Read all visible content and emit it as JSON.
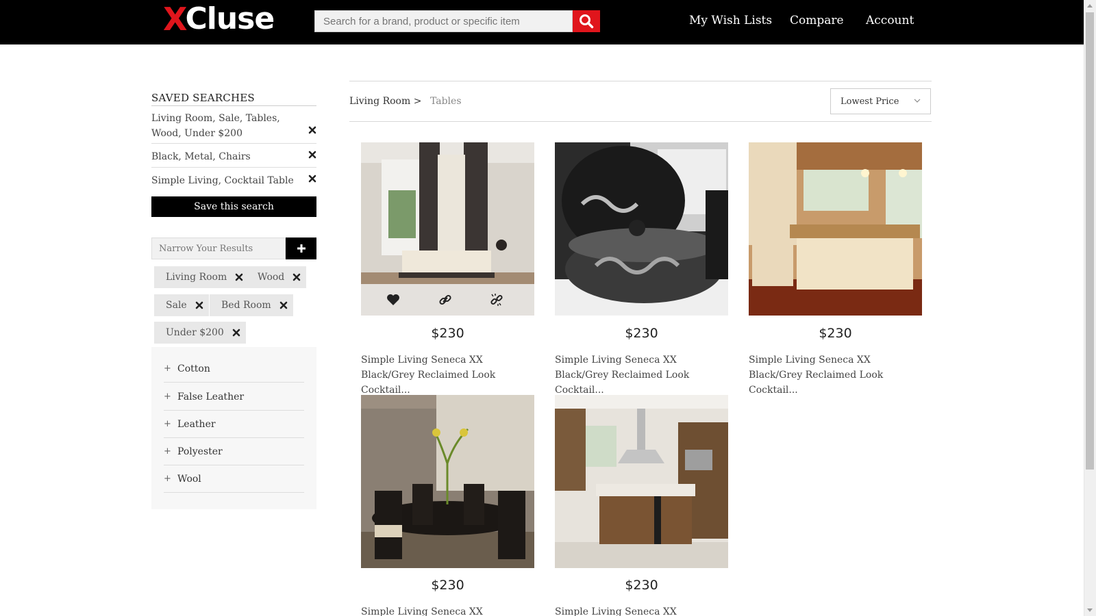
{
  "header": {
    "logo_x": "X",
    "logo_rest": "Cluse",
    "search_placeholder": "Search for a brand, product or specific item",
    "nav": [
      "My Wish Lists",
      "Compare",
      "Account"
    ]
  },
  "sidebar": {
    "saved_title": "SAVED SEARCHES",
    "saved": [
      "Living Room, Sale, Tables, Wood, Under $200",
      "Black, Metal, Chairs",
      "Simple Living, Cocktail Table"
    ],
    "save_button": "Save this search",
    "narrow_placeholder": "Narrow Your Results",
    "chips": [
      "Living Room",
      "Wood",
      "Sale",
      "Bed Room",
      "Under $200"
    ],
    "filters": [
      "Cotton",
      "False Leather",
      "Leather",
      "Polyester",
      "Wool"
    ]
  },
  "main": {
    "breadcrumb": "Living Room >",
    "breadcrumb_current": "Tables",
    "sort": "Lowest Price",
    "products": [
      {
        "price": "$230",
        "title": "Simple Living Seneca XX Black/Grey Reclaimed Look Cocktail...",
        "scene": "bedroom"
      },
      {
        "price": "$230",
        "title": "Simple Living Seneca XX Black/Grey Reclaimed Look Cocktail...",
        "scene": "lounge chair"
      },
      {
        "price": "$230",
        "title": "Simple Living Seneca XX Black/Grey Reclaimed Look Cocktail...",
        "scene": "kitchen"
      },
      {
        "price": "$230",
        "title": "Simple Living Seneca XX Black/Grey",
        "scene": "dining room"
      },
      {
        "price": "$230",
        "title": "Simple Living Seneca XX Black/Grey",
        "scene": "wood kitchen"
      }
    ]
  },
  "colors": {
    "brand_red": "#e0151c",
    "header_bg": "#000000"
  }
}
